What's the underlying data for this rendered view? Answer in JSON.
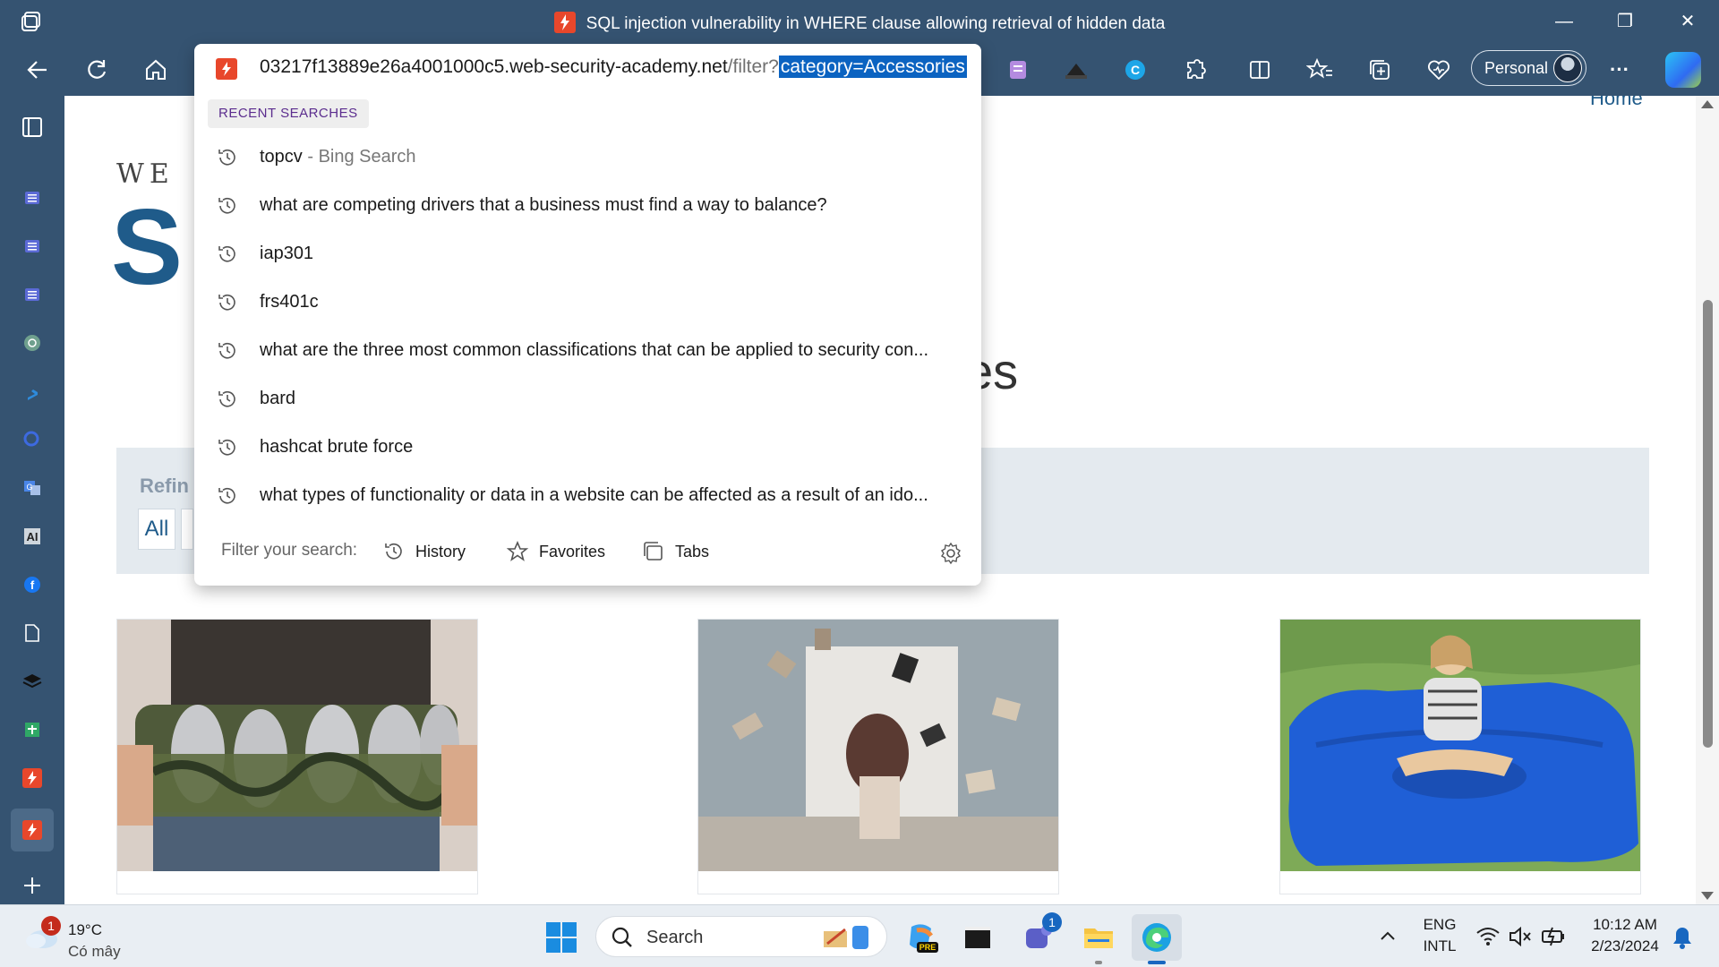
{
  "window": {
    "title": "SQL injection vulnerability in WHERE clause allowing retrieval of hidden data",
    "minimize_glyph": "—",
    "restore_glyph": "❐",
    "close_glyph": "✕"
  },
  "toolbar": {
    "profile_label": "Personal",
    "more_glyph": "···"
  },
  "address_bar": {
    "host": "03217f13889e26a4001000c5.web-security-academy.net",
    "path": "/filter?",
    "selected_query": "category=Accessories"
  },
  "dropdown": {
    "recent_label": "RECENT SEARCHES",
    "suggestions": [
      {
        "text": "topcv",
        "suffix": " - Bing Search"
      },
      {
        "text": "what are competing drivers that a business must find a way to balance?",
        "suffix": ""
      },
      {
        "text": "iap301",
        "suffix": ""
      },
      {
        "text": "frs401c",
        "suffix": ""
      },
      {
        "text": "what are the three most common classifications that can be applied to security con...",
        "suffix": ""
      },
      {
        "text": "bard",
        "suffix": ""
      },
      {
        "text": "hashcat brute force",
        "suffix": ""
      },
      {
        "text": "what types of functionality or data in a website can be affected as a result of an ido...",
        "suffix": ""
      }
    ],
    "filter_label": "Filter your search:",
    "filter_history": "History",
    "filter_favorites": "Favorites",
    "filter_tabs": "Tabs"
  },
  "page": {
    "logo_small": "WE",
    "logo_big": "S",
    "home_link": "Home",
    "heading_fragment": "es",
    "refine_label": "Refin",
    "filter_all": "All"
  },
  "taskbar": {
    "weather_temp": "19°C",
    "weather_condition": "Có mây",
    "weather_badge": "1",
    "search_text": "Search",
    "teams_badge": "1",
    "lang_top": "ENG",
    "lang_bottom": "INTL",
    "time": "10:12 AM",
    "date": "2/23/2024",
    "copilot_pre": "PRE"
  },
  "colors": {
    "chrome": "#355371",
    "brand_blue": "#1f5b8a",
    "selection": "#0b63c1",
    "recent_label": "#5b2d8e",
    "portswigger_orange": "#e8472b"
  }
}
